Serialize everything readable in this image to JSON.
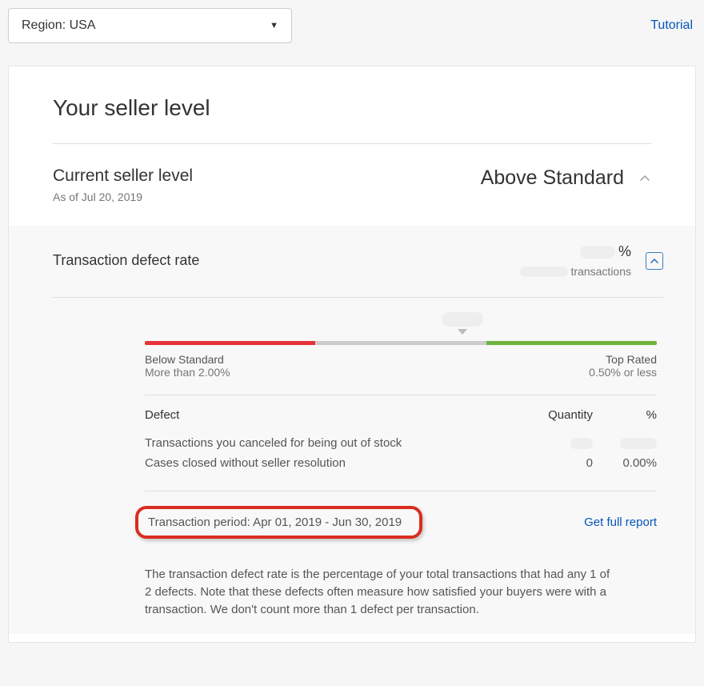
{
  "top": {
    "region_label": "Region: USA",
    "tutorial": "Tutorial"
  },
  "panel": {
    "title": "Your seller level",
    "current_label": "Current seller level",
    "as_of": "As of Jul 20, 2019",
    "level_value": "Above Standard"
  },
  "defect": {
    "section_title": "Transaction defect rate",
    "percent_suffix": "%",
    "transactions_label": "transactions",
    "gauge": {
      "below_label": "Below Standard",
      "below_threshold": "More than 2.00%",
      "top_label": "Top Rated",
      "top_threshold": "0.50% or less"
    },
    "table": {
      "col_defect": "Defect",
      "col_qty": "Quantity",
      "col_pct": "%",
      "rows": [
        {
          "label": "Transactions you canceled for being out of stock",
          "qty": "",
          "pct": ""
        },
        {
          "label": "Cases closed without seller resolution",
          "qty": "0",
          "pct": "0.00%"
        }
      ]
    },
    "period_text": "Transaction period: Apr 01, 2019 - Jun 30, 2019",
    "full_report": "Get full report",
    "description": "The transaction defect rate is the percentage of your total transactions that had any 1 of 2 defects. Note that these defects often measure how satisfied your buyers were with a transaction. We don't count more than 1 defect per transaction."
  }
}
